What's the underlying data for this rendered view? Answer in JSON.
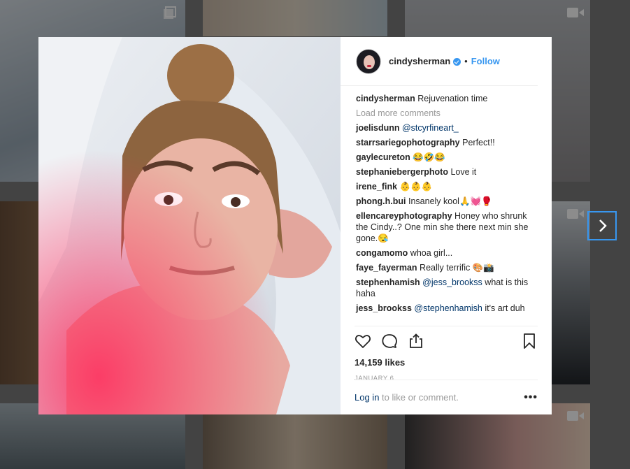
{
  "post": {
    "username": "cindysherman",
    "follow_label": "Follow",
    "dot": "•",
    "caption_user": "cindysherman",
    "caption_text": "Rejuvenation time",
    "load_more": "Load more comments",
    "comments": [
      {
        "user": "joelisdunn",
        "mention": "@stcyrfineart_",
        "text": ""
      },
      {
        "user": "starrsariegophotography",
        "text": "Perfect!!"
      },
      {
        "user": "gaylecureton",
        "text": "😂🤣😂"
      },
      {
        "user": "stephaniebergerphoto",
        "text": "Love it"
      },
      {
        "user": "irene_fink",
        "text": "👶👶👶"
      },
      {
        "user": "phong.h.bui",
        "text": "Insanely kool🙏💓🥊"
      },
      {
        "user": "ellencareyphotography",
        "text": "Honey who shrunk the Cindy..? One min she there next min she gone.😪"
      },
      {
        "user": "congamomo",
        "text": "whoa girl..."
      },
      {
        "user": "faye_fayerman",
        "text": "Really terrific 🎨📸"
      },
      {
        "user": "stephenhamish",
        "mention": "@jess_brookss",
        "text": "what is this haha"
      },
      {
        "user": "jess_brookss",
        "mention": "@stephenhamish",
        "text": "it's art duh"
      }
    ],
    "likes": "14,159 likes",
    "date": "JANUARY 6",
    "login_label": "Log in",
    "comment_prompt": "to like or comment.",
    "more_label": "•••"
  },
  "icons": {
    "like": "heart-icon",
    "comment": "comment-icon",
    "share": "share-icon",
    "save": "bookmark-icon",
    "next": "chevron-right-icon",
    "video": "video-icon",
    "gallery": "gallery-icon"
  },
  "colors": {
    "accent": "#3897f0",
    "link": "#003569",
    "muted": "#999999",
    "text": "#262626"
  }
}
